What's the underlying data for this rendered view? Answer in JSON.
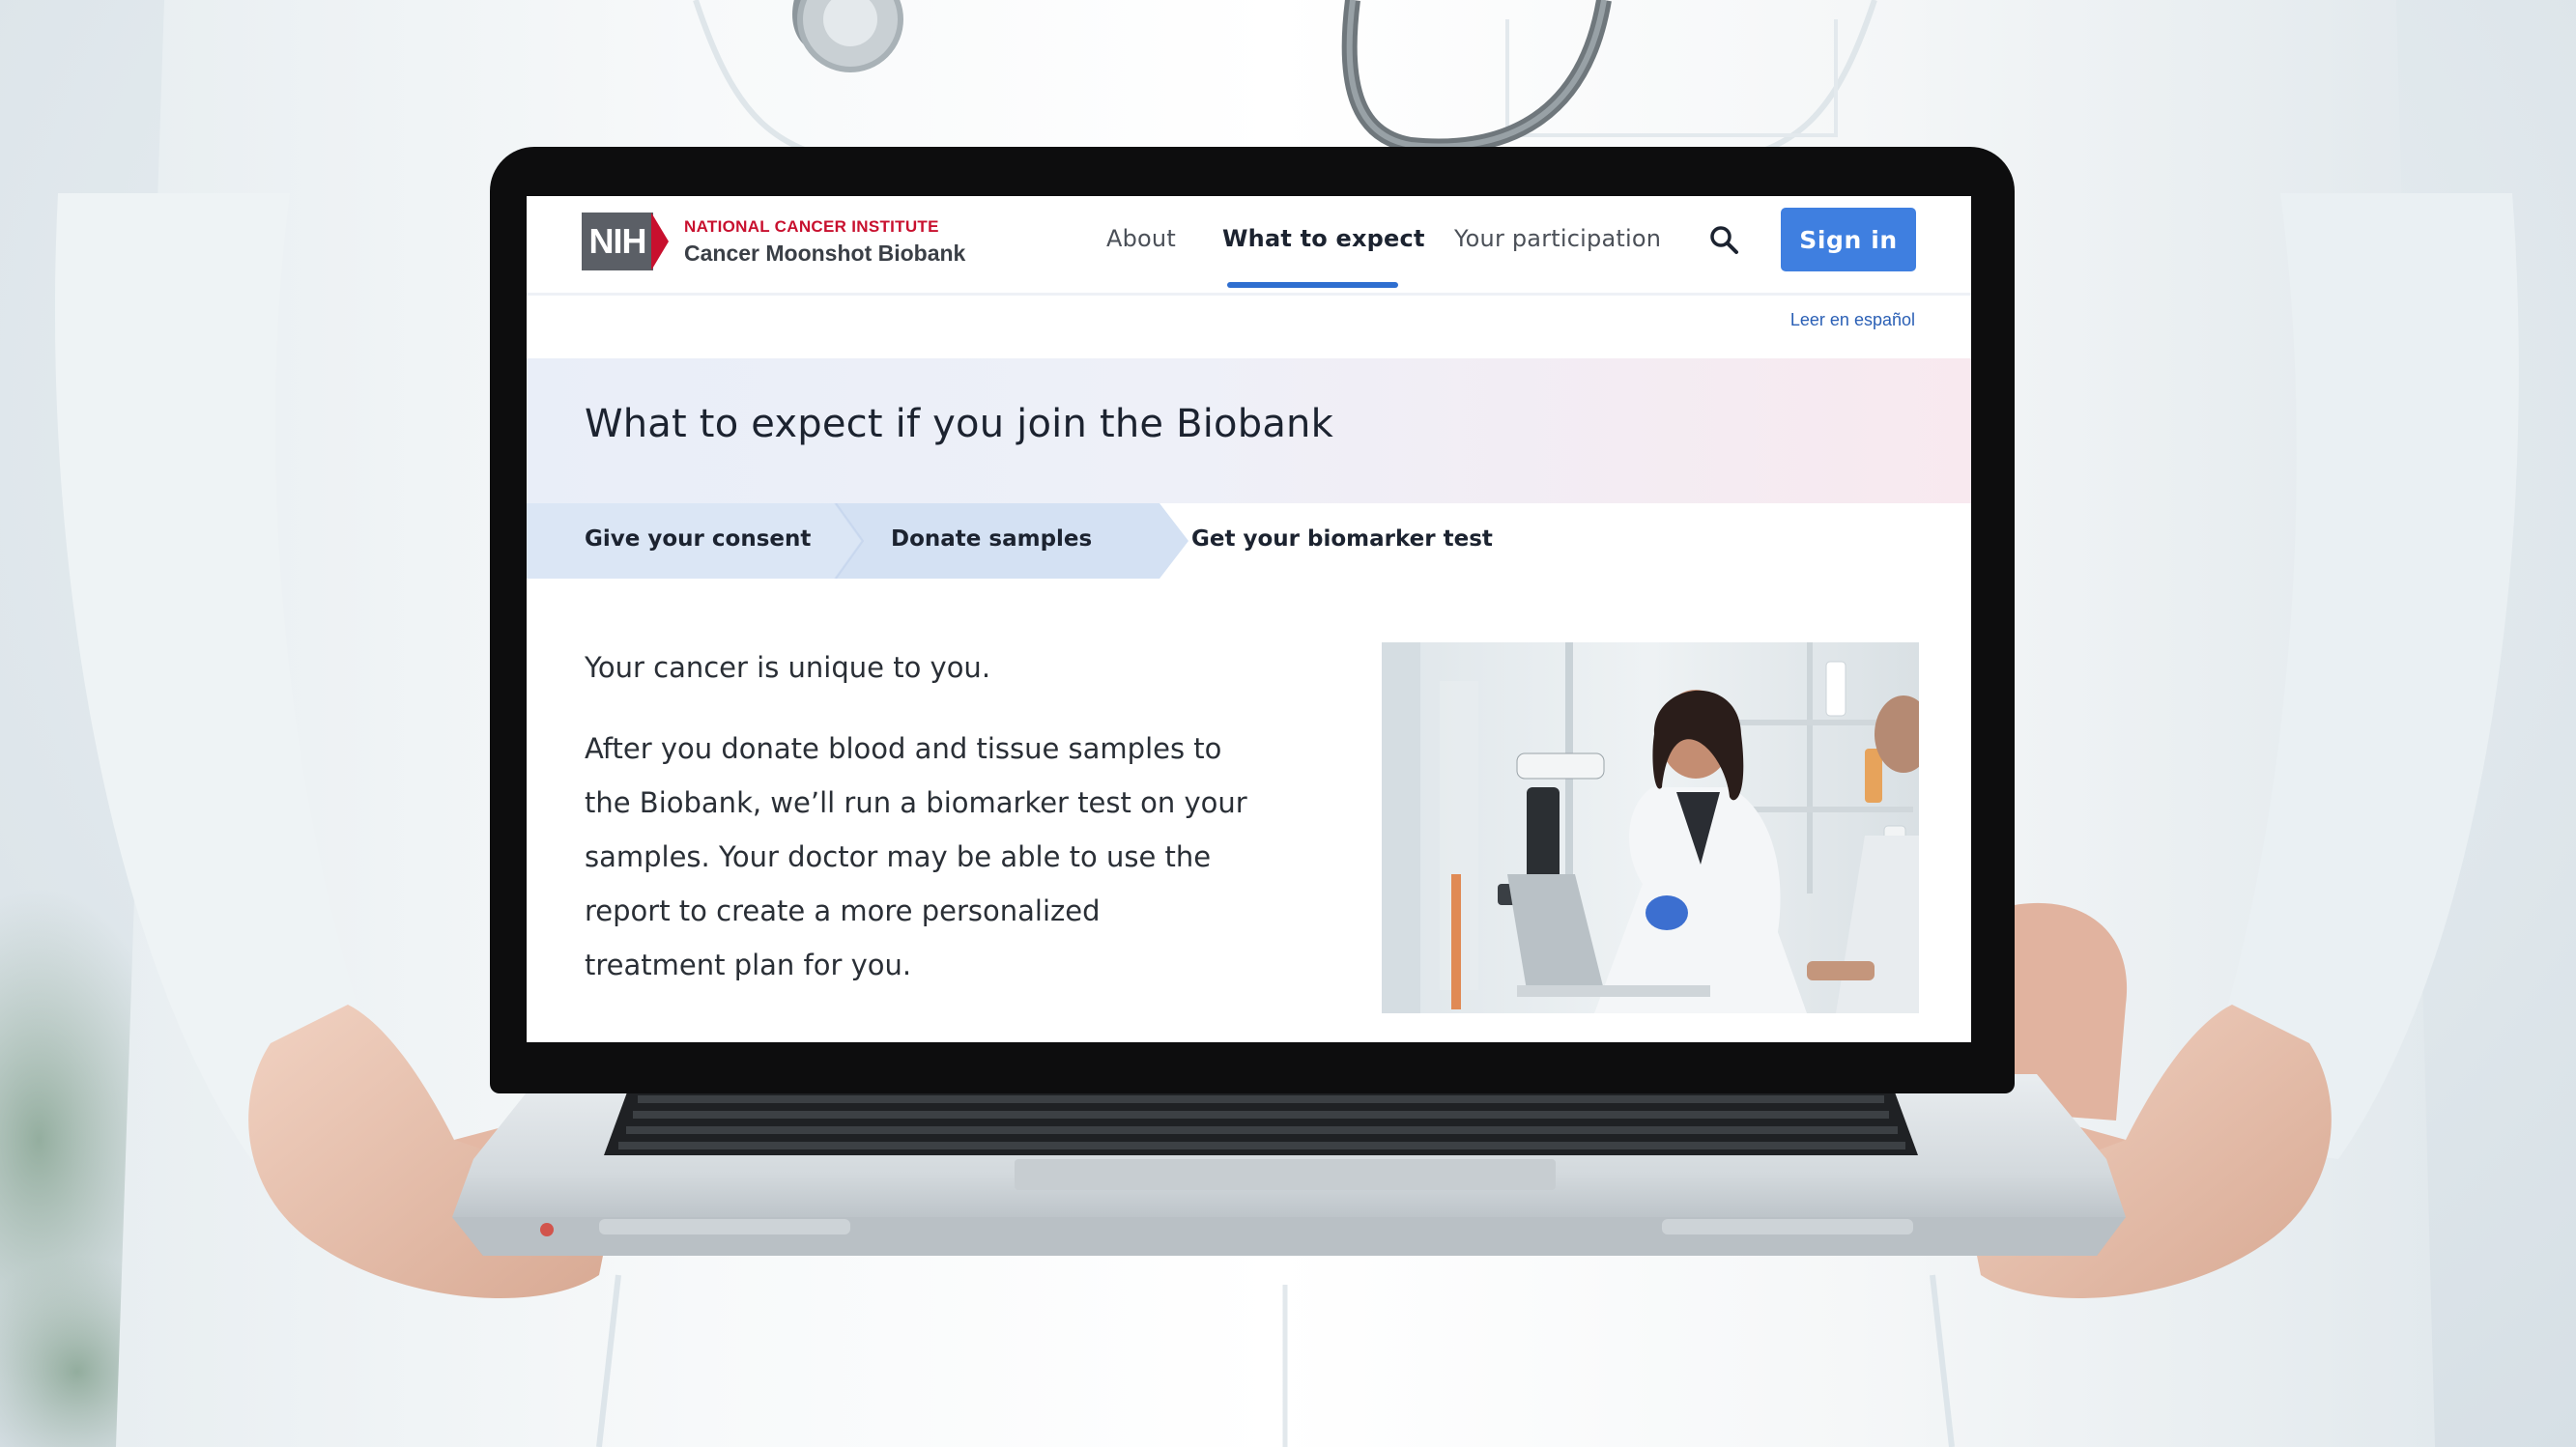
{
  "brand": {
    "logo_mark": "NIH",
    "institute": "NATIONAL CANCER INSTITUTE",
    "program": "Cancer Moonshot Biobank"
  },
  "nav": {
    "items": [
      {
        "label": "About",
        "active": false
      },
      {
        "label": "What to expect",
        "active": true
      },
      {
        "label": "Your participation",
        "active": false
      }
    ],
    "sign_in": "Sign in",
    "search_icon": "search-icon"
  },
  "language_link": "Leer en español",
  "hero": {
    "title": "What to expect if you join the Biobank"
  },
  "steps": [
    {
      "label": "Give your consent",
      "state": "completed"
    },
    {
      "label": "Donate samples",
      "state": "completed"
    },
    {
      "label": "Get your biomarker test",
      "state": "current"
    }
  ],
  "content": {
    "lead": "Your cancer is unique to you.",
    "body_lines": [
      "After you donate blood and tissue samples to",
      "the Biobank, we’ll run a biomarker test on your",
      "samples. Your doctor may be able to use the",
      "report to create a more personalized",
      "treatment plan for you."
    ]
  },
  "colors": {
    "accent": "#3f7fe0",
    "nih_red": "#c8102e",
    "step_fill": "#dbe6f5",
    "bezel": "#0d0d0e"
  }
}
